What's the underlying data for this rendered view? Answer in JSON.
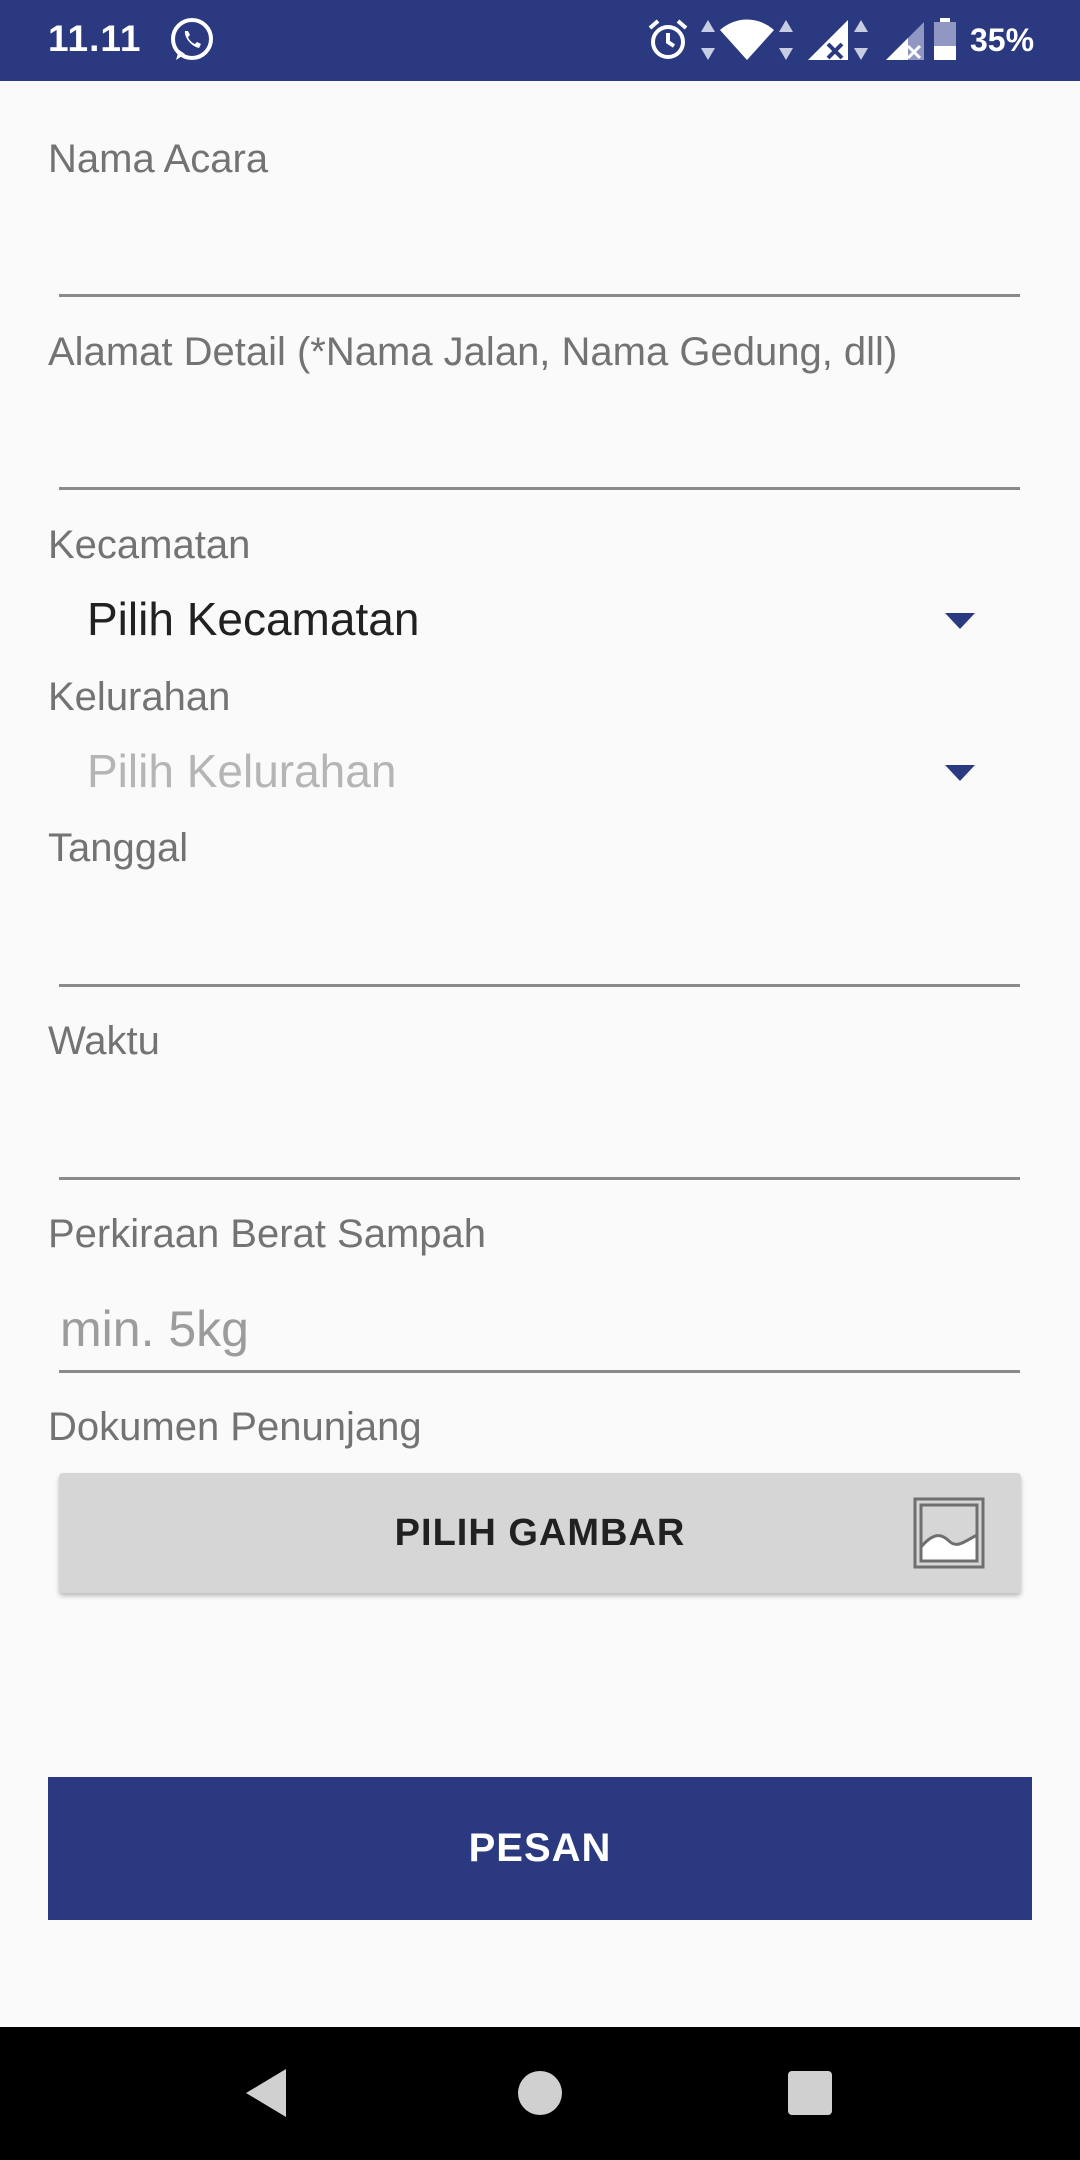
{
  "status_bar": {
    "time": "11.11",
    "battery": "35%",
    "icons": [
      "whatsapp-icon",
      "alarm-icon",
      "wifi-icon",
      "signal-icon",
      "signal-icon-2",
      "battery-icon"
    ],
    "background": "#2b3a80"
  },
  "form": {
    "event_name": {
      "label": "Nama Acara",
      "value": ""
    },
    "address": {
      "label": "Alamat Detail (*Nama Jalan, Nama Gedung, dll)",
      "value": ""
    },
    "district": {
      "label": "Kecamatan",
      "selected": "Pilih Kecamatan"
    },
    "subdistrict": {
      "label": "Kelurahan",
      "selected": "Pilih Kelurahan"
    },
    "date": {
      "label": "Tanggal",
      "value": ""
    },
    "time": {
      "label": "Waktu",
      "value": ""
    },
    "weight": {
      "label": "Perkiraan Berat Sampah",
      "placeholder": "min. 5kg"
    },
    "documents": {
      "label": "Dokumen Penunjang",
      "button_label": "PILIH GAMBAR",
      "button_icon": "image-icon"
    }
  },
  "submit": {
    "label": "PESAN"
  },
  "nav_bar": {
    "buttons": [
      "back-icon",
      "home-icon",
      "recents-icon"
    ]
  },
  "colors": {
    "accent": "#2b3a80",
    "background": "#fafafa",
    "button_gray": "#d6d6d6"
  }
}
